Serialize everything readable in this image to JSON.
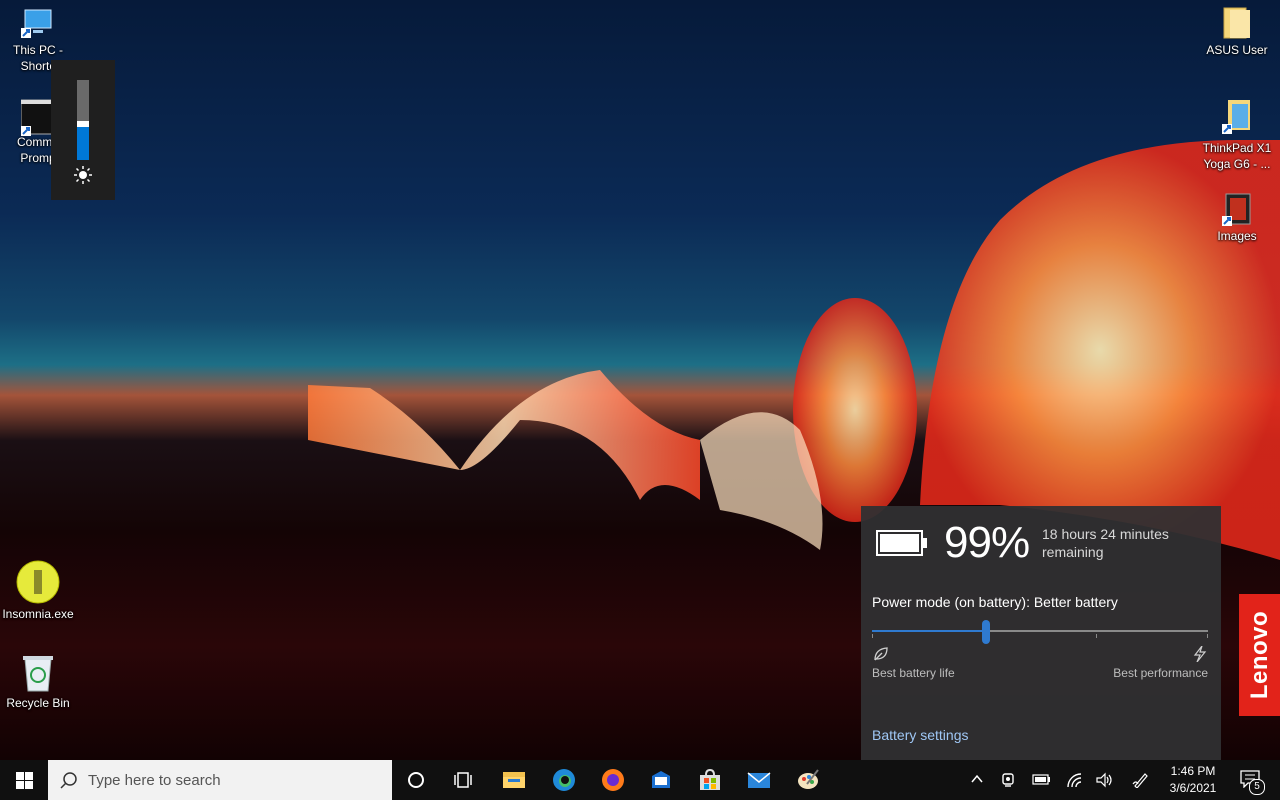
{
  "desktop": {
    "icons": [
      {
        "label": "This PC -\nShortc",
        "icon": "this-pc-icon"
      },
      {
        "label": "Comma\nPromp",
        "icon": "command-prompt-icon"
      },
      {
        "label": "Insomnia.exe",
        "icon": "insomnia-icon"
      },
      {
        "label": "Recycle Bin",
        "icon": "recycle-bin-icon"
      },
      {
        "label": "ASUS User",
        "icon": "folder-icon"
      },
      {
        "label": "ThinkPad X1\nYoga G6 - ...",
        "icon": "document-icon"
      },
      {
        "label": "Images",
        "icon": "images-icon"
      }
    ]
  },
  "brightness": {
    "level_fraction": 0.45,
    "icon": "sun-icon"
  },
  "battery": {
    "percent": "99%",
    "remaining": "18 hours 24 minutes remaining",
    "power_mode_label": "Power mode (on battery): Better battery",
    "slider_fraction": 0.34,
    "left_label": "Best battery life",
    "right_label": "Best performance",
    "settings_link": "Battery settings"
  },
  "lenovo": {
    "text": "Lenovo",
    "color": "#e2231a"
  },
  "taskbar": {
    "search_placeholder": "Type here to search",
    "apps": [
      "cortana-icon",
      "task-view-icon",
      "file-explorer-icon",
      "edge-icon",
      "firefox-icon",
      "outlook-icon",
      "store-icon",
      "mail-icon",
      "paint-icon"
    ],
    "time": "1:46 PM",
    "date": "3/6/2021",
    "notification_count": "5",
    "accent": "#0078d7"
  }
}
